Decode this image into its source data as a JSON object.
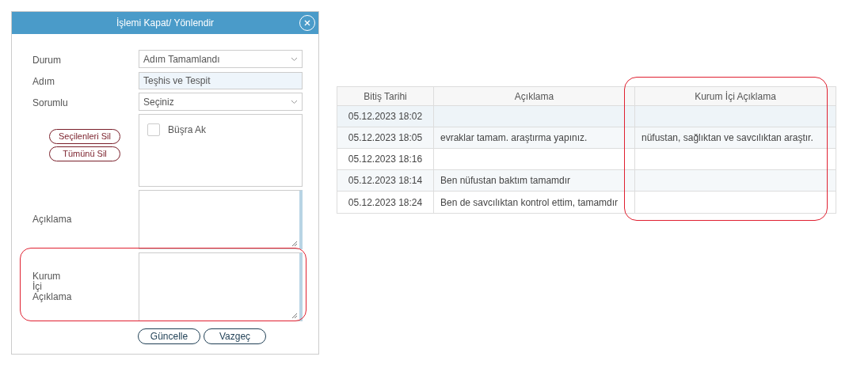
{
  "dialog": {
    "title": "İşlemi Kapat/ Yönlendir",
    "fields": [
      {
        "kind": "select",
        "label": "Durum",
        "value": "Adım Tamamlandı"
      },
      {
        "kind": "text",
        "label": "Adım",
        "value": "Teşhis ve Tespit"
      },
      {
        "kind": "select",
        "label": "Sorumlu",
        "value": "Seçiniz"
      }
    ],
    "list_buttons": [
      "Seçilenleri Sil",
      "Tümünü Sil"
    ],
    "list_items": [
      {
        "label": "Büşra Ak",
        "checked": false
      }
    ],
    "textareas": [
      {
        "label_lines": [
          "Açıklama"
        ],
        "highlighted": false
      },
      {
        "label_lines": [
          "Kurum",
          "İçi",
          "Açıklama"
        ],
        "highlighted": true
      }
    ],
    "buttons": [
      "Güncelle",
      "Vazgeç"
    ]
  },
  "table": {
    "columns": [
      {
        "label": "Bitiş Tarihi",
        "highlighted": false
      },
      {
        "label": "Açıklama",
        "highlighted": false
      },
      {
        "label": "Kurum İçi Açıklama",
        "highlighted": true
      }
    ],
    "rows": [
      {
        "cells": [
          "05.12.2023 18:02",
          "",
          ""
        ]
      },
      {
        "cells": [
          "05.12.2023 18:05",
          "evraklar tamam. araştırma yapınız.",
          "nüfustan, sağlıktan ve savcılıktan araştır."
        ]
      },
      {
        "cells": [
          "05.12.2023 18:16",
          "",
          ""
        ]
      },
      {
        "cells": [
          "05.12.2023 18:14",
          "Ben nüfustan baktım tamamdır",
          ""
        ]
      },
      {
        "cells": [
          "05.12.2023 18:24",
          "Ben de savcılıktan kontrol ettim, tamamdır",
          ""
        ]
      }
    ]
  }
}
